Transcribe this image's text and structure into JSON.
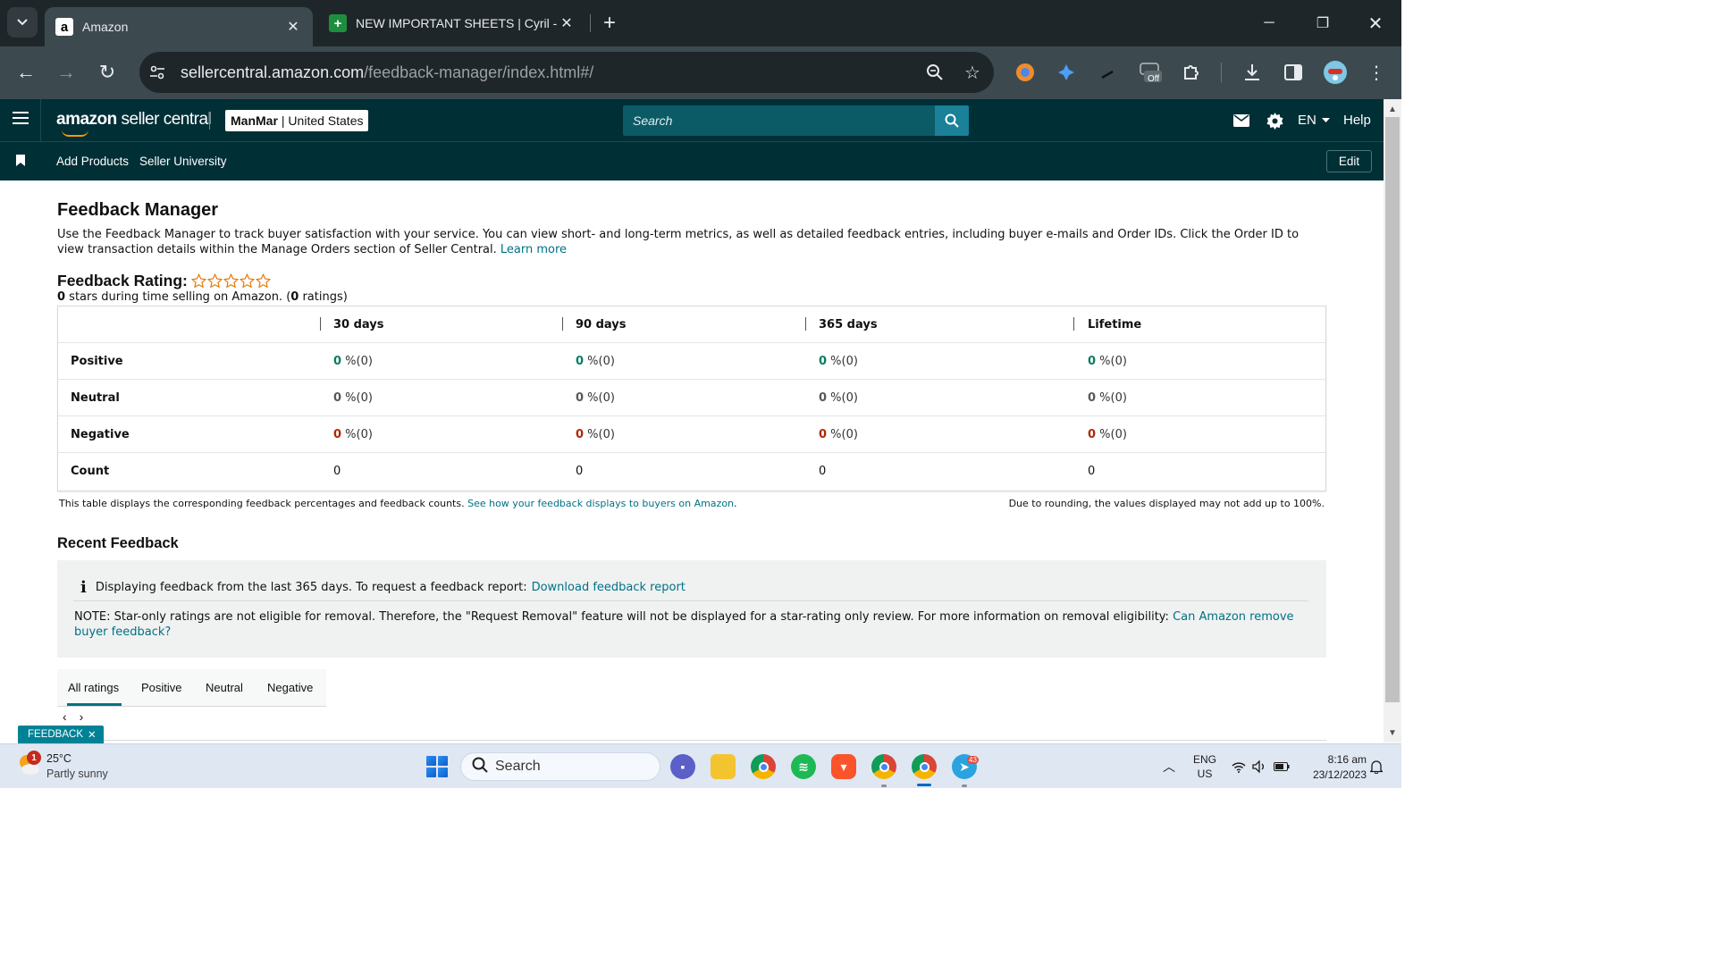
{
  "browser": {
    "tabs": [
      {
        "title": "Amazon",
        "favicon": "a"
      },
      {
        "title": "NEW IMPORTANT SHEETS | Cyril -",
        "favicon": "+"
      }
    ],
    "url_host": "sellercentral.amazon.com",
    "url_path": "/feedback-manager/index.html#/",
    "extension_badge": "Off"
  },
  "header": {
    "logo_brand": "amazon",
    "logo_product": " seller central",
    "account_name": "ManMar",
    "account_region": "| United States",
    "search_placeholder": "Search",
    "language": "EN",
    "help": "Help"
  },
  "subnav": {
    "links": [
      "Add Products",
      "Seller University"
    ],
    "edit": "Edit"
  },
  "page": {
    "title": "Feedback Manager",
    "intro": "Use the Feedback Manager to track buyer satisfaction with your service. You can view short- and long-term metrics, as well as detailed feedback entries, including buyer e-mails and Order IDs. Click the Order ID to view transaction details within the Manage Orders section of Seller Central.",
    "learn_more": "Learn more",
    "rating_title": "Feedback Rating:",
    "rating_stars_filled": 0,
    "rating_stars_total": 5,
    "summary_stars": "0",
    "summary_mid": " stars during time selling on Amazon. (",
    "summary_count": "0",
    "summary_end": " ratings)"
  },
  "metrics": {
    "columns": [
      "30 days",
      "90 days",
      "365 days",
      "Lifetime"
    ],
    "rows": [
      {
        "label": "Positive",
        "values": [
          "0",
          "0",
          "0",
          "0"
        ],
        "suffix": " %(0)"
      },
      {
        "label": "Neutral",
        "values": [
          "0",
          "0",
          "0",
          "0"
        ],
        "suffix": " %(0)"
      },
      {
        "label": "Negative",
        "values": [
          "0",
          "0",
          "0",
          "0"
        ],
        "suffix": " %(0)"
      },
      {
        "label": "Count",
        "values": [
          "0",
          "0",
          "0",
          "0"
        ],
        "suffix": ""
      }
    ],
    "note": "This table displays the corresponding feedback percentages and feedback counts.",
    "note_link": "See how your feedback displays to buyers on Amazon",
    "note_right": "Due to rounding, the values displayed may not add up to 100%."
  },
  "recent": {
    "title": "Recent Feedback",
    "info_text": "Displaying feedback from the last 365 days. To request a feedback report:",
    "info_link": "Download feedback report",
    "note_text": "NOTE: Star-only ratings are not eligible for removal. Therefore, the \"Request Removal\" feature will not be displayed for a star-rating only review. For more information on removal eligibility:",
    "note_link": "Can Amazon remove buyer feedback?",
    "tabs": [
      "All ratings",
      "Positive",
      "Neutral",
      "Negative"
    ],
    "active_tab": "All ratings",
    "prev": "‹",
    "next": "›"
  },
  "feedback_tag": "FEEDBACK",
  "taskbar": {
    "weather_temp": "25°C",
    "weather_desc": "Partly sunny",
    "weather_badge": "1",
    "search": "Search",
    "telegram_badge": "43",
    "lang_top": "ENG",
    "lang_bottom": "US",
    "time": "8:16 am",
    "date": "23/12/2023"
  },
  "colors": {
    "header_bg": "#002f36",
    "link": "#007185",
    "positive": "#067d62",
    "negative": "#b12704",
    "star": "#e77600"
  }
}
